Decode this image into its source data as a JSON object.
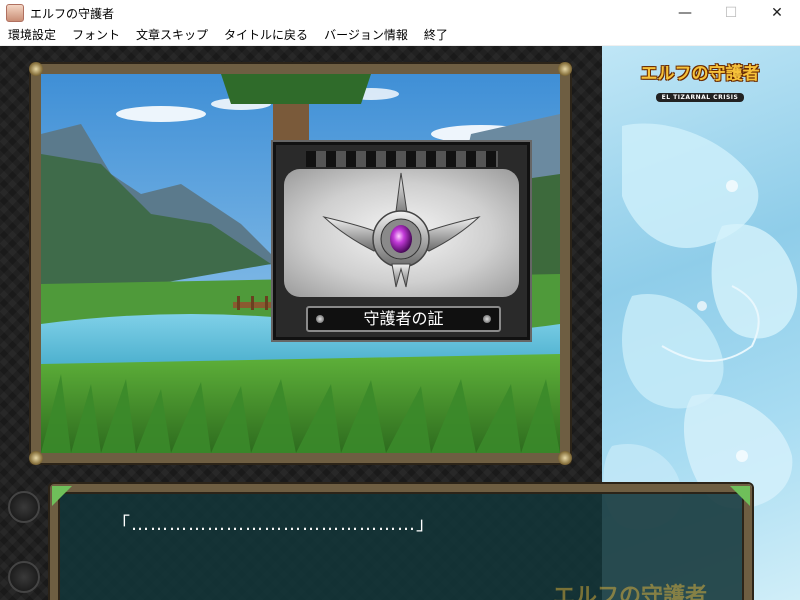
{
  "window": {
    "title": "エルフの守護者",
    "controls": {
      "minimize": "—",
      "maximize": "☐",
      "close": "✕"
    }
  },
  "menu": {
    "items": [
      "環境設定",
      "フォント",
      "文章スキップ",
      "タイトルに戻る",
      "バージョン情報",
      "終了"
    ]
  },
  "logo": {
    "title": "エルフの守護者",
    "subtitle": "EL TIZARNAL CRISIS"
  },
  "item_popup": {
    "name": "守護者の証"
  },
  "dialog": {
    "text": "「………………………………………」",
    "watermark": "エルフの守護者"
  },
  "colors": {
    "frame_gold": "#6e5e42",
    "dialog_bg": "#123438",
    "logo_gold": "#f6c23a",
    "gem_purple": "#b02ad0"
  }
}
